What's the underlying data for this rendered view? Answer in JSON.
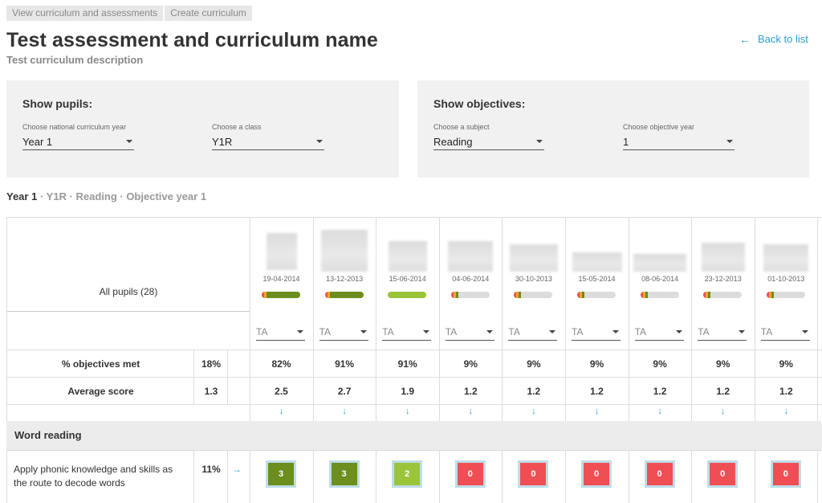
{
  "tabs": [
    {
      "label": "View curriculum and assessments"
    },
    {
      "label": "Create curriculum"
    }
  ],
  "header": {
    "title": "Test assessment and curriculum name",
    "description": "Test curriculum description",
    "back_label": "Back to list",
    "back_arrow": "←"
  },
  "pupils_panel": {
    "title": "Show pupils:",
    "year_label": "Choose national curriculum year",
    "year_value": "Year 1",
    "class_label": "Choose a class",
    "class_value": "Y1R"
  },
  "objectives_panel": {
    "title": "Show objectives:",
    "subject_label": "Choose a subject",
    "subject_value": "Reading",
    "year_label": "Choose objective year",
    "year_value": "1"
  },
  "summary": {
    "year": "Year 1",
    "rest": " · Y1R · Reading · Objective year 1"
  },
  "table": {
    "all_pupils": "All pupils (28)",
    "ta_label": "TA",
    "down_arrow": "↓",
    "rows": [
      {
        "label": "% objectives met",
        "total": "18%"
      },
      {
        "label": "Average score",
        "total": "1.3"
      }
    ],
    "pupils": [
      {
        "date": "19-04-2014",
        "progress": 0.82,
        "pct_met": "82%",
        "avg": "2.5",
        "score": "3",
        "score_color": "#6b8e1e"
      },
      {
        "date": "13-12-2013",
        "progress": 0.91,
        "pct_met": "91%",
        "avg": "2.7",
        "score": "3",
        "score_color": "#6b8e1e"
      },
      {
        "date": "15-06-2014",
        "progress": 0.91,
        "pct_met": "91%",
        "avg": "1.9",
        "score": "2",
        "score_color": "#9ac43a"
      },
      {
        "date": "04-06-2014",
        "progress": 0.09,
        "pct_met": "9%",
        "avg": "1.2",
        "score": "0",
        "score_color": "#ef4e55"
      },
      {
        "date": "30-10-2013",
        "progress": 0.09,
        "pct_met": "9%",
        "avg": "1.2",
        "score": "0",
        "score_color": "#ef4e55"
      },
      {
        "date": "15-05-2014",
        "progress": 0.09,
        "pct_met": "9%",
        "avg": "1.2",
        "score": "0",
        "score_color": "#ef4e55"
      },
      {
        "date": "08-06-2014",
        "progress": 0.09,
        "pct_met": "9%",
        "avg": "1.2",
        "score": "0",
        "score_color": "#ef4e55"
      },
      {
        "date": "23-12-2013",
        "progress": 0.09,
        "pct_met": "9%",
        "avg": "1.2",
        "score": "0",
        "score_color": "#ef4e55"
      },
      {
        "date": "01-10-2013",
        "progress": 0.09,
        "pct_met": "9%",
        "avg": "1.2",
        "score": "0",
        "score_color": "#ef4e55"
      }
    ],
    "section": {
      "title": "Word reading",
      "objective": "Apply phonic knowledge and skills as the route to decode words",
      "objective_pct": "11%",
      "objective_arrow": "→"
    }
  },
  "colors": {
    "accent": "#2b9cd8",
    "dark_green": "#6b8e1e",
    "light_green": "#9ac43a",
    "red": "#ef4e55",
    "orange": "#f5a623"
  }
}
